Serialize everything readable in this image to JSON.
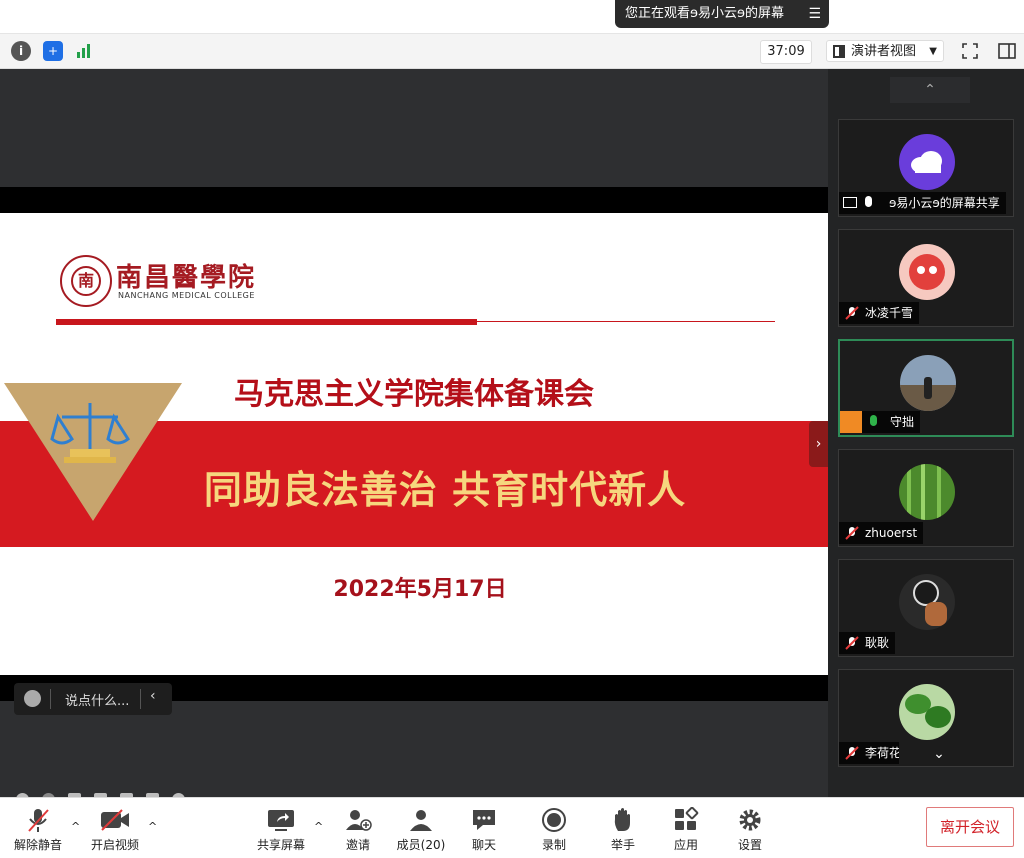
{
  "banner": {
    "text": "您正在观看ɘ易小云ɘ的屏幕",
    "menu_icon": "list-icon"
  },
  "toolbar": {
    "timer": "37:09",
    "view_label": "演讲者视图",
    "icons": [
      "info-icon",
      "shield-icon",
      "signal-icon",
      "fullscreen-icon",
      "sidebar-toggle-icon"
    ]
  },
  "slide": {
    "logo_cn": "南昌醫學院",
    "logo_en": "NANCHANG MEDICAL COLLEGE",
    "title": "马克思主义学院集体备课会",
    "subtitle": "同助良法善治  共育时代新人",
    "date": "2022年5月17日"
  },
  "chat": {
    "placeholder": "说点什么..."
  },
  "participants": [
    {
      "name": "ɘ易小云ɘ的屏幕共享",
      "status": "sharing"
    },
    {
      "name": "冰凌千雪",
      "status": "muted"
    },
    {
      "name": "守拙",
      "status": "speaking"
    },
    {
      "name": "zhuoerst",
      "status": "muted"
    },
    {
      "name": "耿耿",
      "status": "muted"
    },
    {
      "name": "李荷花",
      "status": "muted"
    }
  ],
  "bottom": {
    "unmute": "解除静音",
    "video": "开启视频",
    "share": "共享屏幕",
    "invite": "邀请",
    "members": "成员(20)",
    "chat": "聊天",
    "record": "录制",
    "raise_hand": "举手",
    "apps": "应用",
    "settings": "设置",
    "leave": "离开会议"
  },
  "colors": {
    "accent_red": "#d51a20",
    "title_red": "#b40f19",
    "gold": "#f6d77e",
    "leave_red": "#d2232a"
  }
}
